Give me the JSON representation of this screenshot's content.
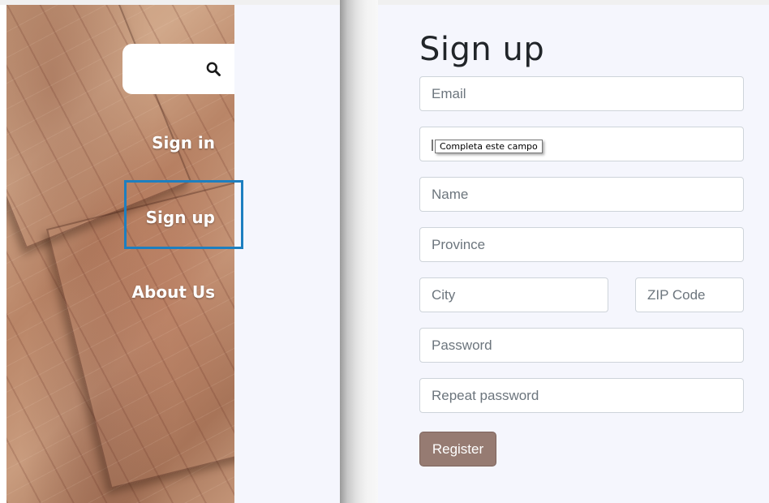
{
  "sidebar": {
    "search_icon": "search-icon",
    "nav": [
      {
        "label": "Sign in"
      },
      {
        "label": "Sign up"
      },
      {
        "label": "About Us"
      }
    ]
  },
  "form": {
    "title": "Sign up",
    "fields": {
      "email": {
        "placeholder": "Email",
        "value": ""
      },
      "username": {
        "placeholder": "",
        "value": ""
      },
      "name": {
        "placeholder": "Name",
        "value": ""
      },
      "province": {
        "placeholder": "Province",
        "value": ""
      },
      "city": {
        "placeholder": "City",
        "value": ""
      },
      "zip": {
        "placeholder": "ZIP Code",
        "value": ""
      },
      "password": {
        "placeholder": "Password",
        "value": ""
      },
      "repeat_password": {
        "placeholder": "Repeat password",
        "value": ""
      }
    },
    "validation_tooltip": "Completa este campo",
    "register_label": "Register"
  },
  "colors": {
    "accent_focus": "#1d7fc0",
    "register_button": "#967b72",
    "panel_background": "#f5f6fd"
  }
}
